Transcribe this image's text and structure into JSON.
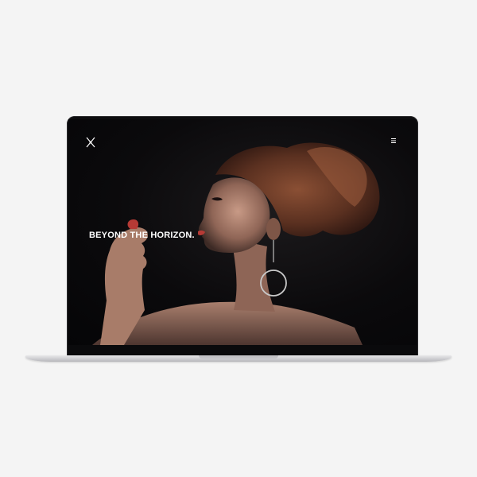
{
  "hero": {
    "title": "BEYOND THE HORIZON."
  },
  "header": {
    "logo_icon": "x-logo-icon",
    "menu_icon": "hamburger-menu-icon"
  },
  "colors": {
    "background": "#f4f4f4",
    "screen": "#060608",
    "title_text": "#ffffff",
    "laptop_silver": "#d2d2d5"
  }
}
